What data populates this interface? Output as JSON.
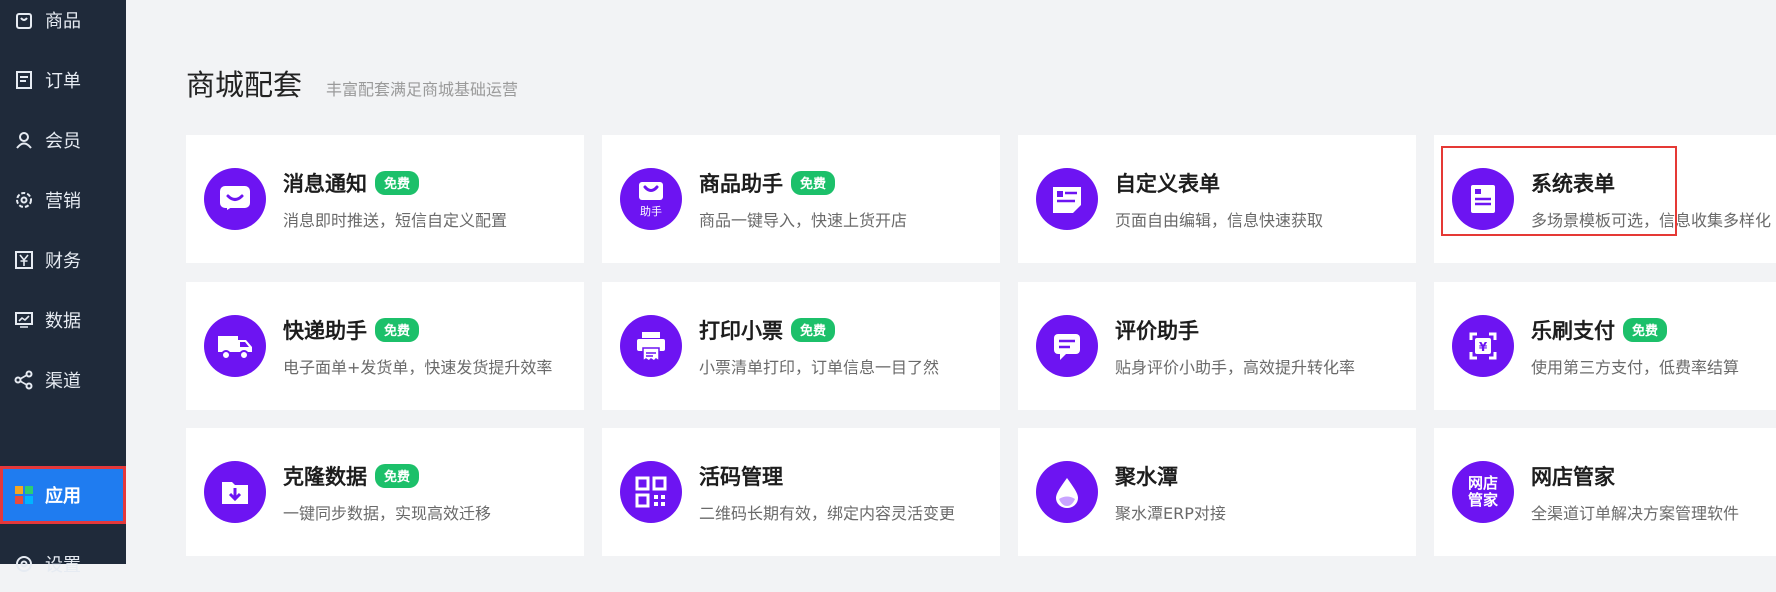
{
  "sidebar": {
    "items": [
      {
        "label": "商品",
        "icon": "shopping-bag-icon"
      },
      {
        "label": "订单",
        "icon": "order-list-icon"
      },
      {
        "label": "会员",
        "icon": "user-icon"
      },
      {
        "label": "营销",
        "icon": "gear-badge-icon"
      },
      {
        "label": "财务",
        "icon": "yen-icon"
      },
      {
        "label": "数据",
        "icon": "monitor-chart-icon"
      },
      {
        "label": "渠道",
        "icon": "share-nodes-icon"
      },
      {
        "label": "应用",
        "icon": "apps-grid-icon",
        "active": true
      },
      {
        "label": "设置",
        "icon": "settings-icon"
      }
    ]
  },
  "header": {
    "title": "商城配套",
    "subtitle": "丰富配套满足商城基础运营"
  },
  "cards": [
    {
      "name": "消息通知",
      "badge": "免费",
      "desc": "消息即时推送，短信自定义配置",
      "icon": "message-smile-icon"
    },
    {
      "name": "商品助手",
      "badge": "免费",
      "desc": "商品一键导入，快速上货开店",
      "icon": "bag-helper-icon",
      "icon_text": "助手"
    },
    {
      "name": "自定义表单",
      "badge": "",
      "desc": "页面自由编辑，信息快速获取",
      "icon": "form-edit-icon"
    },
    {
      "name": "系统表单",
      "badge": "",
      "desc": "多场景模板可选，信息收集多样化",
      "icon": "form-document-icon"
    },
    {
      "name": "快递助手",
      "badge": "免费",
      "desc": "电子面单+发货单，快速发货提升效率",
      "icon": "delivery-truck-icon"
    },
    {
      "name": "打印小票",
      "badge": "免费",
      "desc": "小票清单打印，订单信息一目了然",
      "icon": "printer-icon"
    },
    {
      "name": "评价助手",
      "badge": "",
      "desc": "贴身评价小助手，高效提升转化率",
      "icon": "comment-icon"
    },
    {
      "name": "乐刷支付",
      "badge": "免费",
      "desc": "使用第三方支付，低费率结算",
      "icon": "yen-scan-icon",
      "icon_text": "¥"
    },
    {
      "name": "克隆数据",
      "badge": "免费",
      "desc": "一键同步数据，实现高效迁移",
      "icon": "folder-download-icon"
    },
    {
      "name": "活码管理",
      "badge": "",
      "desc": "二维码长期有效，绑定内容灵活变更",
      "icon": "qr-code-icon"
    },
    {
      "name": "聚水潭",
      "badge": "",
      "desc": "聚水潭ERP对接",
      "icon": "water-drop-icon"
    },
    {
      "name": "网店管家",
      "badge": "",
      "desc": "全渠道订单解决方案管理软件",
      "icon": "shop-manager-icon",
      "icon_text": "网店管家"
    }
  ],
  "colors": {
    "sidebar_bg": "#1f2a3a",
    "active_bg": "#1f7cf0",
    "icon_purple": "#6d14f2",
    "badge_green": "#1cc06a",
    "highlight_red": "#e53935"
  }
}
